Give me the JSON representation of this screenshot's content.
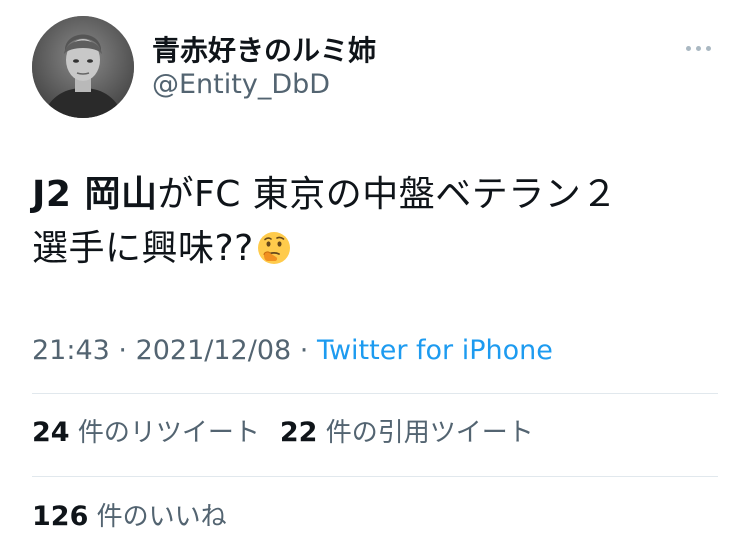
{
  "user": {
    "display_name": "青赤好きのルミ姉",
    "handle": "@Entity_DbD"
  },
  "tweet": {
    "text_bold": "J2 岡山",
    "text_line1_rest": "がFC 東京の中盤ベテラン２",
    "text_line2": "選手に興味??",
    "emoji": "thinking-face-icon"
  },
  "meta": {
    "time": "21:43",
    "separator1": " · ",
    "date": "2021/12/08",
    "separator2": " · ",
    "source": "Twitter for iPhone"
  },
  "stats": {
    "retweets_count": "24",
    "retweets_label": "件のリツイート",
    "quotes_count": "22",
    "quotes_label": "件の引用ツイート",
    "likes_count": "126",
    "likes_label": "件のいいね"
  },
  "colors": {
    "link": "#1d9bf0",
    "secondary_text": "#536471",
    "primary_text": "#0f1419",
    "divider": "#e1e8ed"
  }
}
